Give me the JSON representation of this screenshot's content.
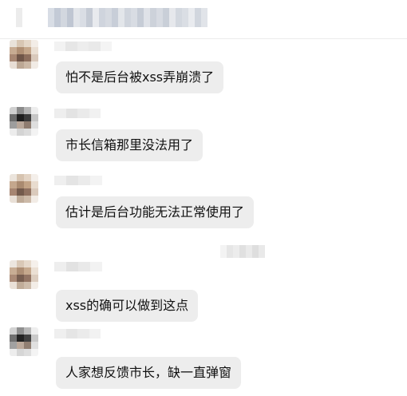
{
  "messages": [
    {
      "text": "怕不是后台被xss弄崩溃了"
    },
    {
      "text": "市长信箱那里没法用了"
    },
    {
      "text": "估计是后台功能无法正常使用了"
    },
    {
      "text": "xss的确可以做到这点"
    },
    {
      "text": "人家想反馈市长，缺一直弹窗"
    }
  ]
}
